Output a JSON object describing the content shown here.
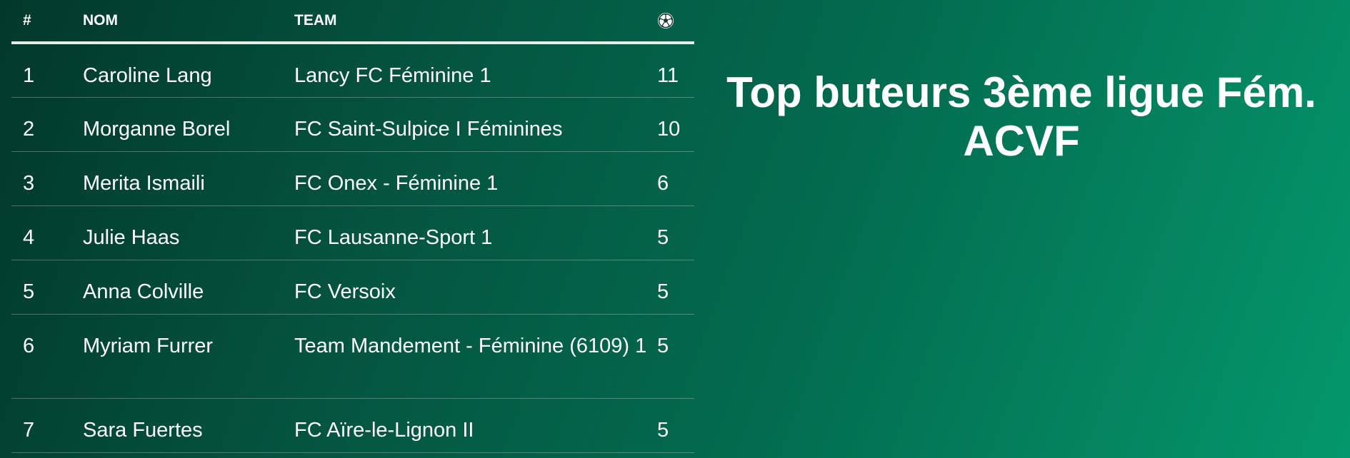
{
  "title": "Top buteurs 3ème ligue Fém. ACVF",
  "table": {
    "headers": {
      "rank": "#",
      "name": "NOM",
      "team": "TEAM",
      "goals_icon": "soccer-ball-icon"
    },
    "rows": [
      {
        "rank": "1",
        "name": "Caroline Lang",
        "team": "Lancy FC Féminine 1",
        "goals": "11"
      },
      {
        "rank": "2",
        "name": "Morganne Borel",
        "team": "FC Saint-Sulpice I Féminines",
        "goals": "10"
      },
      {
        "rank": "3",
        "name": "Merita Ismaili",
        "team": "FC Onex - Féminine 1",
        "goals": "6"
      },
      {
        "rank": "4",
        "name": "Julie Haas",
        "team": "FC Lausanne-Sport 1",
        "goals": "5"
      },
      {
        "rank": "5",
        "name": "Anna Colville",
        "team": "FC Versoix",
        "goals": "5"
      },
      {
        "rank": "6",
        "name": "Myriam Furrer",
        "team": "Team Mandement - Féminine (6109) 1",
        "goals": "5"
      },
      {
        "rank": "7",
        "name": "Sara Fuertes",
        "team": "FC Aïre-le-Lignon II",
        "goals": "5"
      }
    ]
  },
  "colors": {
    "background_start": "#02382b",
    "background_end": "#04976c",
    "text": "#ffffff",
    "header_rule": "#e8ece9"
  }
}
